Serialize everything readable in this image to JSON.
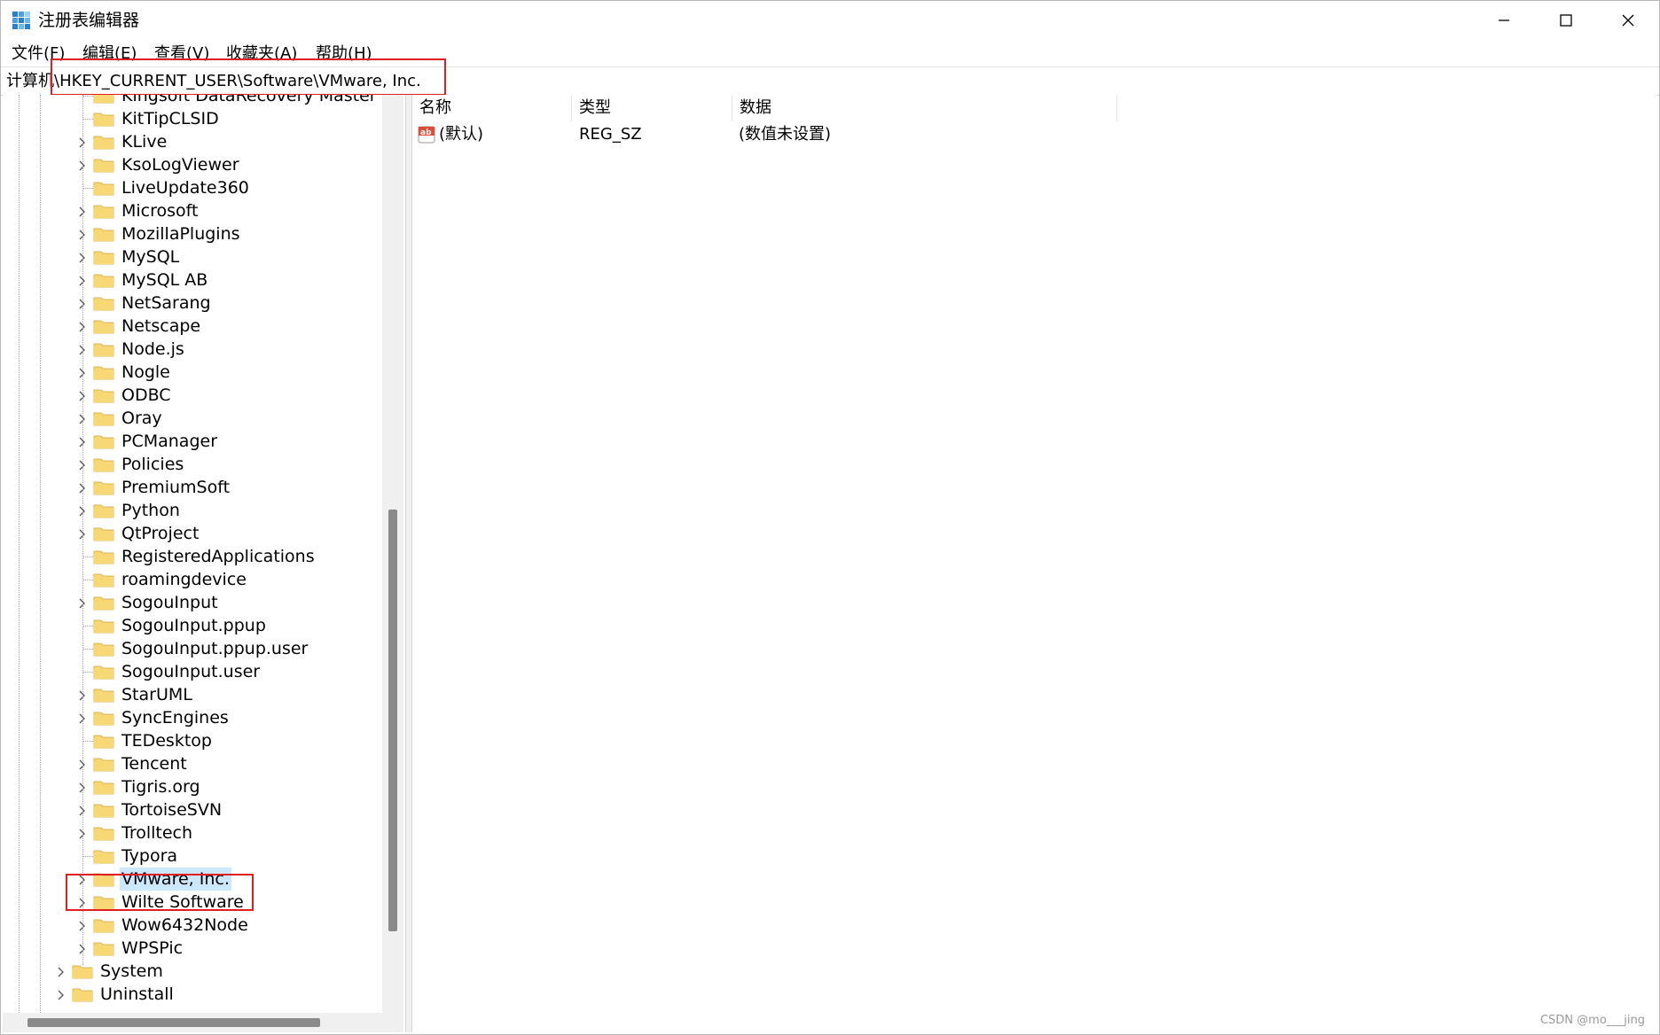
{
  "window": {
    "title": "注册表编辑器"
  },
  "menu": [
    "文件(F)",
    "编辑(E)",
    "查看(V)",
    "收藏夹(A)",
    "帮助(H)"
  ],
  "address": {
    "path": "计算机\\HKEY_CURRENT_USER\\Software\\VMware, Inc."
  },
  "tree": {
    "items": [
      {
        "label": "Kingsoft DataRecovery Master",
        "expandable": false
      },
      {
        "label": "KitTipCLSID",
        "expandable": false
      },
      {
        "label": "KLive",
        "expandable": true
      },
      {
        "label": "KsoLogViewer",
        "expandable": true
      },
      {
        "label": "LiveUpdate360",
        "expandable": false
      },
      {
        "label": "Microsoft",
        "expandable": true
      },
      {
        "label": "MozillaPlugins",
        "expandable": true
      },
      {
        "label": "MySQL",
        "expandable": true
      },
      {
        "label": "MySQL AB",
        "expandable": true
      },
      {
        "label": "NetSarang",
        "expandable": true
      },
      {
        "label": "Netscape",
        "expandable": true
      },
      {
        "label": "Node.js",
        "expandable": true
      },
      {
        "label": "Nogle",
        "expandable": true
      },
      {
        "label": "ODBC",
        "expandable": true
      },
      {
        "label": "Oray",
        "expandable": true
      },
      {
        "label": "PCManager",
        "expandable": true
      },
      {
        "label": "Policies",
        "expandable": true
      },
      {
        "label": "PremiumSoft",
        "expandable": true
      },
      {
        "label": "Python",
        "expandable": true
      },
      {
        "label": "QtProject",
        "expandable": true
      },
      {
        "label": "RegisteredApplications",
        "expandable": false
      },
      {
        "label": "roamingdevice",
        "expandable": false
      },
      {
        "label": "SogouInput",
        "expandable": true
      },
      {
        "label": "SogouInput.ppup",
        "expandable": false
      },
      {
        "label": "SogouInput.ppup.user",
        "expandable": false
      },
      {
        "label": "SogouInput.user",
        "expandable": false
      },
      {
        "label": "StarUML",
        "expandable": true
      },
      {
        "label": "SyncEngines",
        "expandable": true
      },
      {
        "label": "TEDesktop",
        "expandable": false
      },
      {
        "label": "Tencent",
        "expandable": true
      },
      {
        "label": "Tigris.org",
        "expandable": true
      },
      {
        "label": "TortoiseSVN",
        "expandable": true
      },
      {
        "label": "Trolltech",
        "expandable": true
      },
      {
        "label": "Typora",
        "expandable": false
      },
      {
        "label": "VMware, Inc.",
        "expandable": true,
        "selected": true
      },
      {
        "label": "Wilte Software",
        "expandable": true
      },
      {
        "label": "Wow6432Node",
        "expandable": true
      },
      {
        "label": "WPSPic",
        "expandable": true
      }
    ],
    "root_items": [
      {
        "label": "System",
        "expandable": true
      },
      {
        "label": "Uninstall",
        "expandable": true
      }
    ]
  },
  "list": {
    "columns": [
      "名称",
      "类型",
      "数据"
    ],
    "rows": [
      {
        "name": "(默认)",
        "type": "REG_SZ",
        "data": "(数值未设置)"
      }
    ]
  },
  "watermark": "CSDN @mo___jing",
  "colors": {
    "folder": "#f8d775",
    "selection": "#cce8ff",
    "annotation": "#e02020"
  }
}
